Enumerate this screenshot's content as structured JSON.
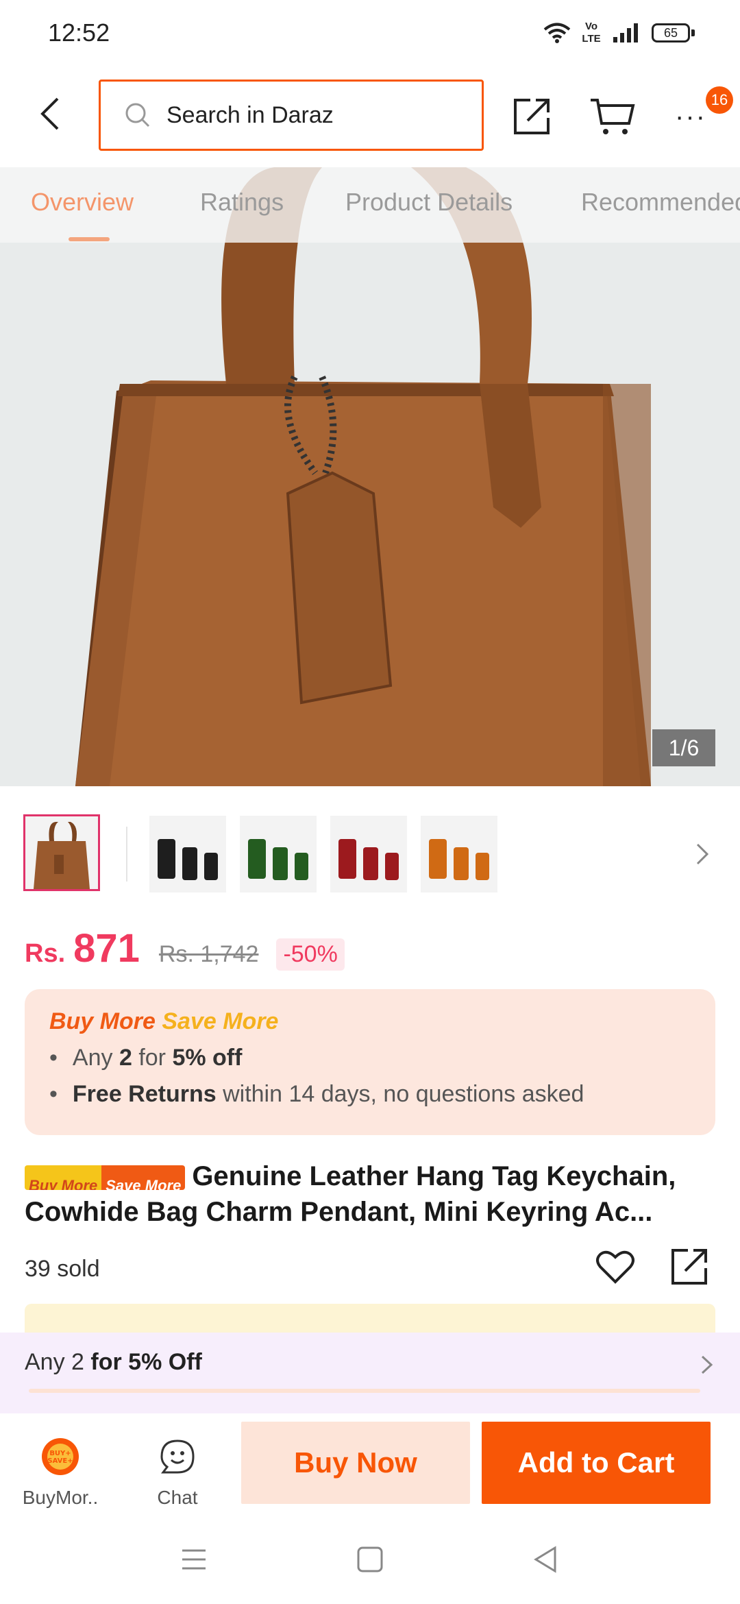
{
  "status_bar": {
    "time": "12:52",
    "lte": "Vo LTE",
    "battery": "65"
  },
  "header": {
    "search_placeholder": "Search in Daraz",
    "cart_badge": "16"
  },
  "tabs": [
    "Overview",
    "Ratings",
    "Product Details",
    "Recommended"
  ],
  "gallery": {
    "counter": "1/6",
    "thumbnails": [
      "brown-bag",
      "black-tags",
      "green-tags",
      "red-tags",
      "orange-tags"
    ]
  },
  "price": {
    "currency": "Rs.",
    "current": "871",
    "original": "Rs. 1,742",
    "discount": "-50%"
  },
  "promo": {
    "title_part1": "Buy More",
    "title_part2": "Save More",
    "line1_prefix": "Any ",
    "line1_qty": "2",
    "line1_mid": " for ",
    "line1_off": "5% off",
    "line2_bold": "Free Returns",
    "line2_rest": " within 14 days, no questions asked"
  },
  "product": {
    "tag_part1": "Buy More",
    "tag_part2": "Save More",
    "title": "Genuine Leather Hang Tag Keychain, Cowhide Bag Charm Pendant, Mini Keyring Ac...",
    "sold": "39 sold"
  },
  "offer_bar": {
    "prefix": "Any 2 ",
    "bold": "for 5% Off"
  },
  "actions": {
    "buymore_label": "BuyMor..",
    "chat_label": "Chat",
    "buy_now": "Buy Now",
    "add_to_cart": "Add to Cart"
  },
  "colors": {
    "accent": "#f85606",
    "price": "#f03a5f"
  }
}
